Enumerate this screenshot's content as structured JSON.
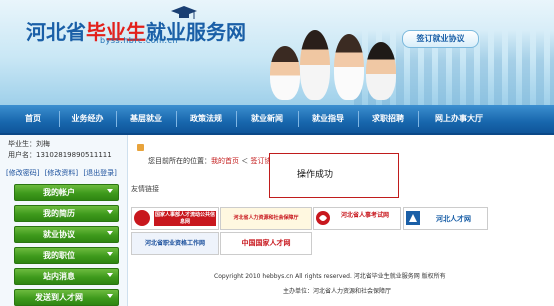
{
  "header": {
    "logo_part1": "河北省",
    "logo_part2": "毕业生",
    "logo_part3": "就业服务网",
    "logo_url": "byss.hbrc.com.cn",
    "sign_button": "签订就业协议"
  },
  "nav": [
    "首页",
    "业务经办",
    "基层就业",
    "政策法规",
    "就业新闻",
    "就业指导",
    "求职招聘",
    "网上办事大厅"
  ],
  "user": {
    "name_line": "毕业生：刘梅",
    "account_line": "用户名：13102819890511111",
    "links": [
      "[修改密码]",
      "[修改资料]",
      "[退出登录]"
    ]
  },
  "menu": [
    "我的帐户",
    "我的简历",
    "就业协议",
    "我的职位",
    "站内消息",
    "发送到人才网"
  ],
  "breadcrumb": {
    "prefix": "您目前所在的位置：",
    "home": "我的首页",
    "sep": " ＜ ",
    "current": "签订协议"
  },
  "dialog": {
    "message": "操作成功"
  },
  "links": {
    "title": "友情链接",
    "items": [
      "国家人事部人才流动公共信息网",
      "河北省人力资源和社会保障厅",
      "河北省人事考试网",
      "河北人才网",
      "河北省职业资格工作网",
      "中国国家人才网"
    ]
  },
  "footer": {
    "copyright": "Copyright 2010 hebbys.cn All rights reserved. 河北省毕业生就业服务网 版权所有",
    "sponsor": "主办单位：河北省人力资源和社会保障厅"
  },
  "colors": {
    "nav": "#1867ad",
    "menu": "#3e9a1c",
    "accent": "#c41f1f"
  }
}
